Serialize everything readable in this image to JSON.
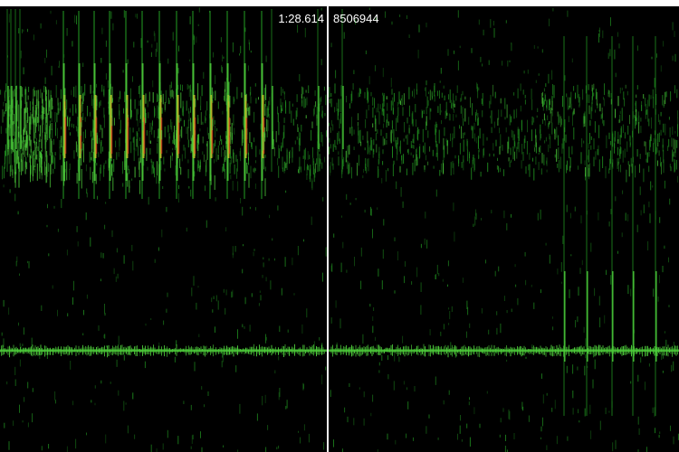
{
  "playback": {
    "time": "1:28.614",
    "sample_position": "8506944"
  },
  "colors": {
    "background": "#000000",
    "signal_low": "#1f8a1f",
    "signal_mid": "#4cc93a",
    "signal_high": "#c9c22a",
    "signal_peak": "#d2431f",
    "playhead": "#f2f2f2"
  }
}
